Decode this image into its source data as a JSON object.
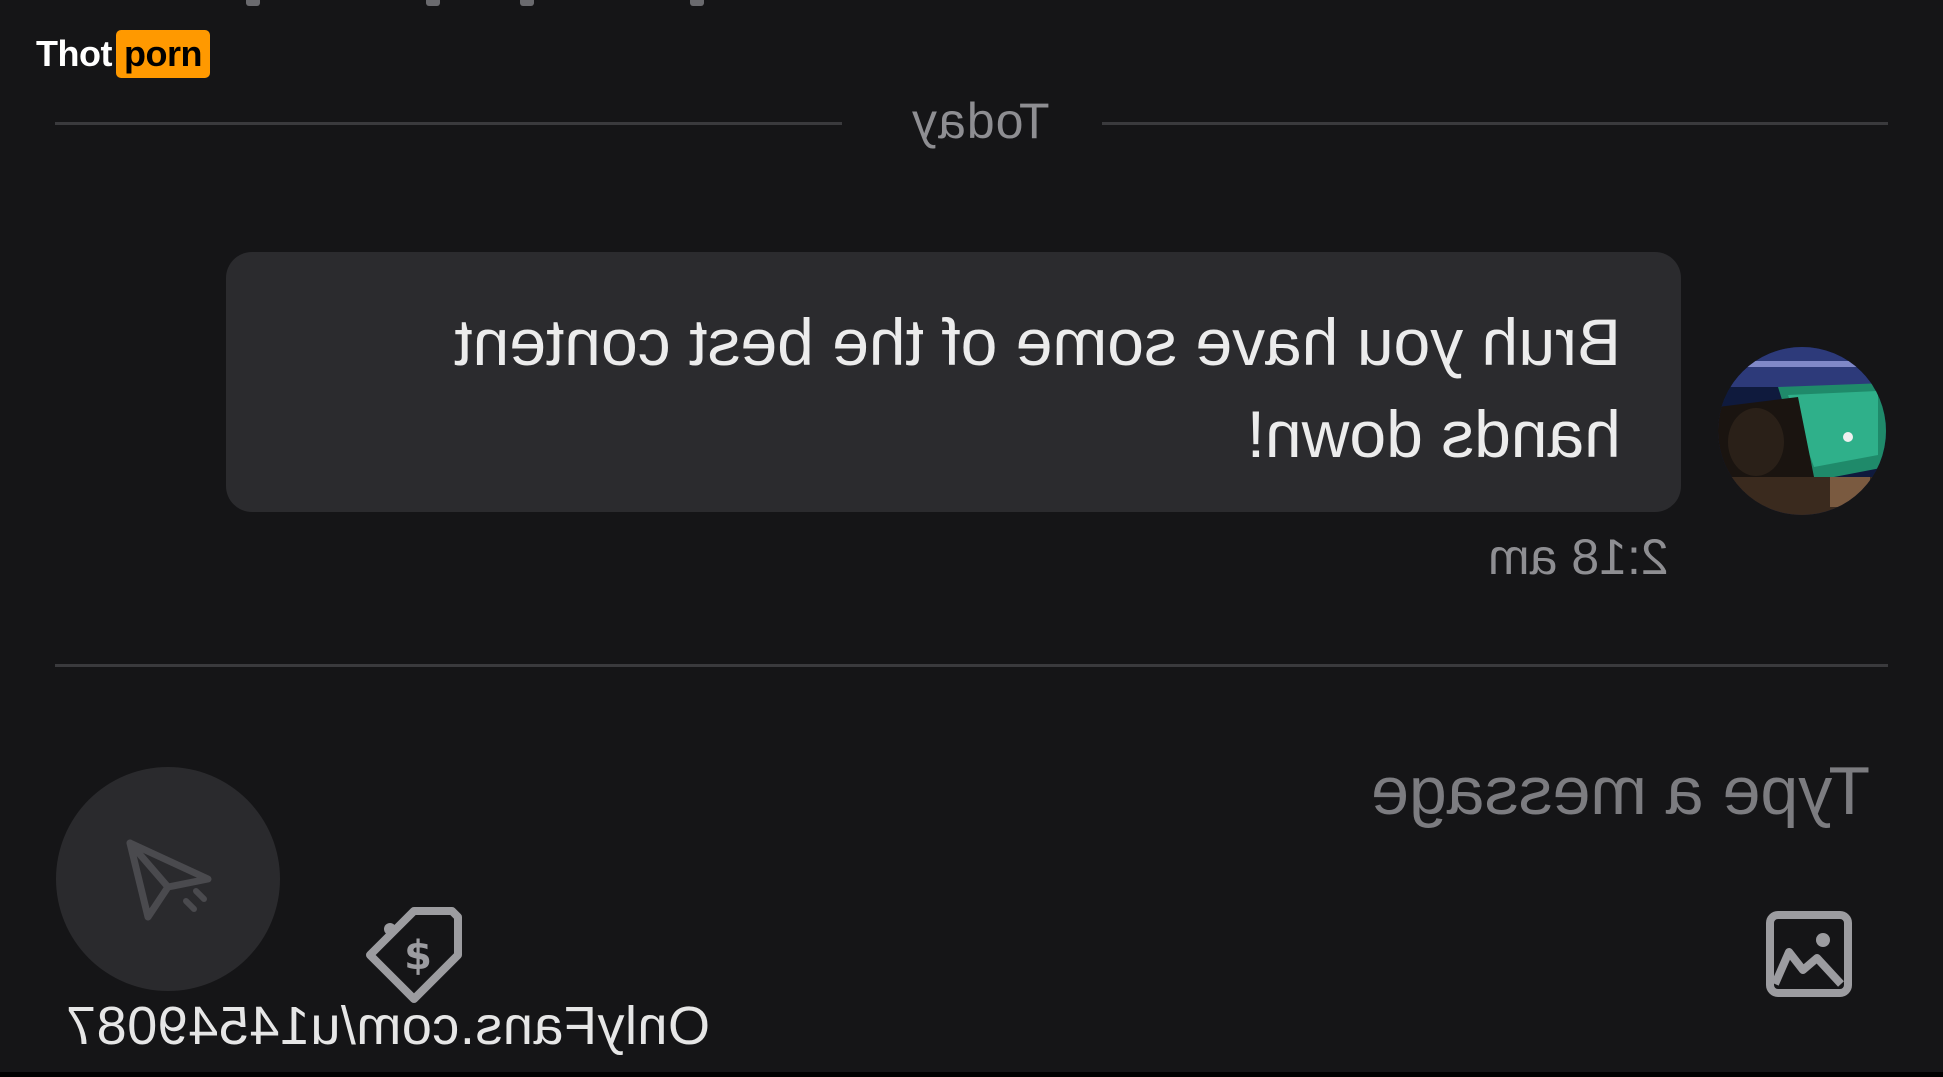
{
  "watermark": {
    "part1": "Thot",
    "part2": "porn"
  },
  "chat": {
    "day_label": "Today",
    "messages": [
      {
        "text_line1": "Bruh you have some of the best content",
        "text_line2": "hands down!",
        "time": "2:18 am"
      }
    ]
  },
  "composer": {
    "placeholder": "Type a message"
  },
  "overlay": {
    "profile_url": "OnlyFans.com/u145490​87"
  },
  "icons": {
    "send": "send-icon",
    "price": "price-tag-icon",
    "media": "image-icon"
  },
  "colors": {
    "background": "#151517",
    "bubble": "#2b2b2e",
    "watermark_accent": "#ff9900",
    "muted_text": "#8e8e92"
  }
}
